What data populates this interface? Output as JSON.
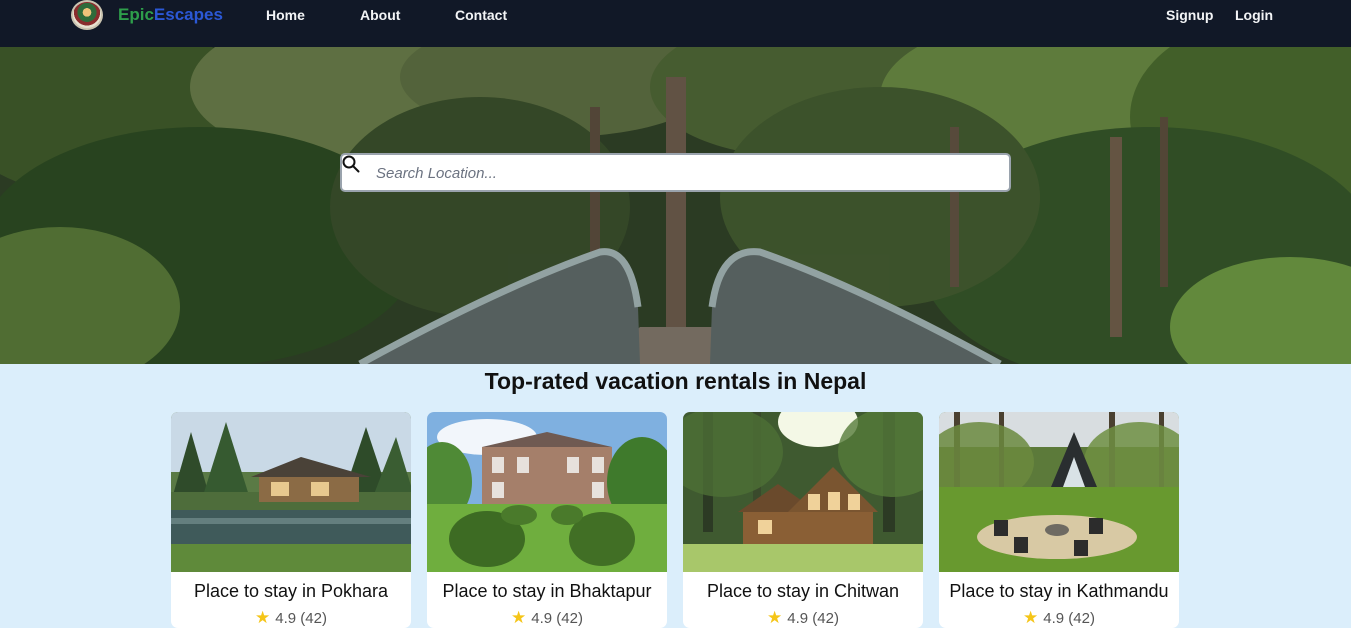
{
  "brand": {
    "part1": "Epic",
    "part2": "Escapes"
  },
  "nav": {
    "home": "Home",
    "about": "About",
    "contact": "Contact",
    "signup": "Signup",
    "login": "Login"
  },
  "search": {
    "placeholder": "Search Location..."
  },
  "section": {
    "title": "Top-rated vacation rentals in Nepal"
  },
  "cards": [
    {
      "title": "Place to stay in Pokhara",
      "rating": "4.9",
      "reviews": "(42)"
    },
    {
      "title": "Place to stay in Bhaktapur",
      "rating": "4.9",
      "reviews": "(42)"
    },
    {
      "title": "Place to stay in Chitwan",
      "rating": "4.9",
      "reviews": "(42)"
    },
    {
      "title": "Place to stay in Kathmandu",
      "rating": "4.9",
      "reviews": "(42)"
    }
  ],
  "colors": {
    "navbar": "#111827",
    "brand_green": "#2e9e4b",
    "brand_blue": "#2b58d6",
    "page_bg": "#dbeefb",
    "star": "#f5c518"
  },
  "icons": {
    "search": "search-icon",
    "star": "star-icon"
  }
}
